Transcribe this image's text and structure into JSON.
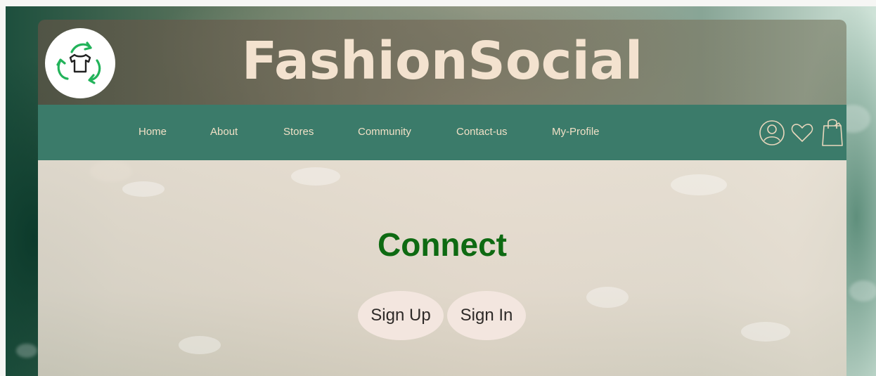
{
  "header": {
    "title": "FashionSocial",
    "logo_icon": "recycle-shirt-icon"
  },
  "nav": {
    "items": [
      {
        "label": "Home"
      },
      {
        "label": "About"
      },
      {
        "label": "Stores"
      },
      {
        "label": "Community"
      },
      {
        "label": "Contact-us"
      },
      {
        "label": "My-Profile"
      }
    ],
    "icons": [
      "user-icon",
      "heart-icon",
      "shopping-bag-icon"
    ]
  },
  "main": {
    "heading": "Connect",
    "buttons": {
      "sign_up": "Sign Up",
      "sign_in": "Sign In"
    }
  },
  "colors": {
    "nav_bg": "#3b7b6a",
    "title_text": "#f3e2cf",
    "nav_text": "#f1e0c6",
    "heading_green": "#0e6a12",
    "logo_green": "#22b35a",
    "button_bg": "#f3e6df"
  }
}
